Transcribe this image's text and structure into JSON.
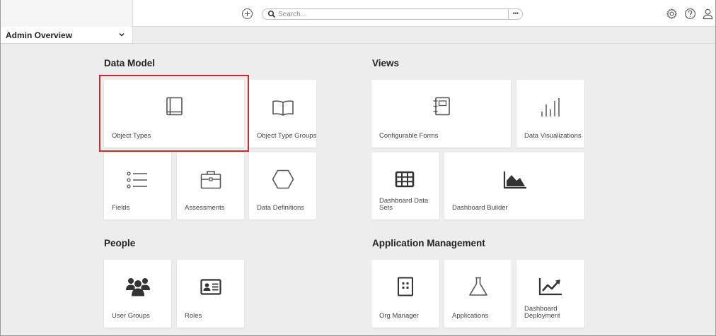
{
  "topbar": {
    "search": {
      "placeholder": "Search...",
      "more": "•••"
    },
    "icons": [
      "add-circle-icon",
      "search-icon",
      "more-icon",
      "gear-icon",
      "help-icon",
      "user-icon"
    ]
  },
  "subbar": {
    "title": "Admin Overview"
  },
  "sections": {
    "data_model": {
      "title": "Data Model",
      "tiles": {
        "object_types": "Object Types",
        "object_type_groups": "Object Type Groups",
        "fields": "Fields",
        "assessments": "Assessments",
        "data_definitions": "Data Definitions"
      }
    },
    "views": {
      "title": "Views",
      "tiles": {
        "configurable_forms": "Configurable Forms",
        "data_visualizations": "Data Visualizations",
        "dashboard_data_sets": "Dashboard Data Sets",
        "dashboard_builder": "Dashboard Builder"
      }
    },
    "people": {
      "title": "People",
      "tiles": {
        "user_groups": "User Groups",
        "roles": "Roles"
      }
    },
    "app_mgmt": {
      "title": "Application Management",
      "tiles": {
        "org_manager": "Org Manager",
        "applications": "Applications",
        "dashboard_deployment": "Dashboard Deployment"
      }
    }
  },
  "colors": {
    "highlight": "#d02b2b",
    "background": "#ededed",
    "tile": "#ffffff"
  }
}
